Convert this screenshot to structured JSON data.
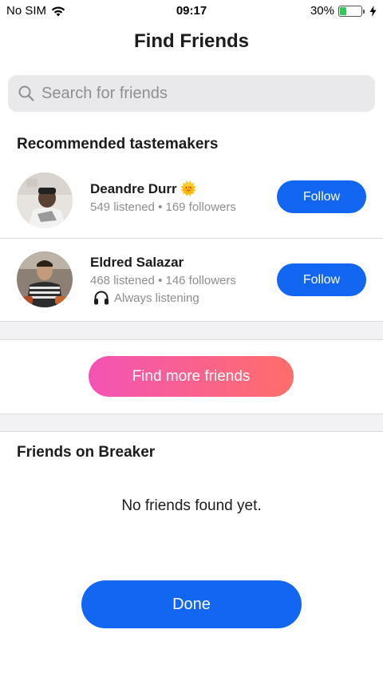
{
  "status_bar": {
    "carrier": "No SIM",
    "time": "09:17",
    "battery_percent": "30%",
    "battery_level": 0.3,
    "icons": [
      "wifi-icon",
      "battery-icon",
      "charging-bolt-icon"
    ]
  },
  "header": {
    "title": "Find Friends"
  },
  "search": {
    "placeholder": "Search for friends",
    "value": ""
  },
  "recommended": {
    "heading": "Recommended tastemakers",
    "users": [
      {
        "name": "Deandre Durr",
        "emoji": "🌞",
        "stats": "549 listened • 169 followers",
        "status": "",
        "follow_label": "Follow"
      },
      {
        "name": "Eldred Salazar",
        "emoji": "",
        "stats": "468 listened • 146 followers",
        "status": "Always listening",
        "status_icon": "headphones-icon",
        "follow_label": "Follow"
      }
    ]
  },
  "find_more": {
    "label": "Find more friends"
  },
  "friends_on_breaker": {
    "heading": "Friends on Breaker",
    "empty_message": "No friends found yet."
  },
  "footer": {
    "done_label": "Done"
  },
  "colors": {
    "primary_blue": "#1266f1",
    "gradient_start": "#f354b4",
    "gradient_end": "#ff6e6a",
    "secondary_text": "#8e8e93",
    "search_bg": "#e9e9eb"
  }
}
